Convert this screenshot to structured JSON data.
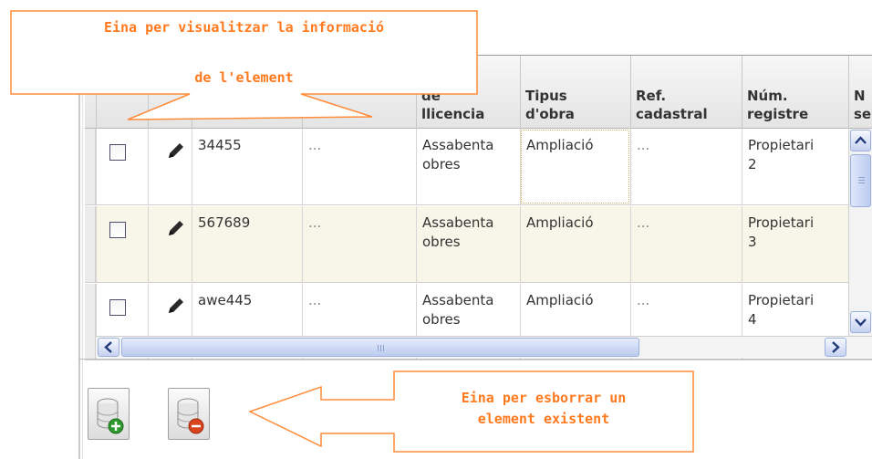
{
  "grid": {
    "headers": [
      {
        "label": ""
      },
      {
        "label": ""
      },
      {
        "label": ""
      },
      {
        "label": ""
      },
      {
        "label": "de\nllicencia"
      },
      {
        "label": "Tipus\nd'obra"
      },
      {
        "label": "Ref.\ncadastral"
      },
      {
        "label": "Núm.\nregistre"
      },
      {
        "label": "N\nse"
      }
    ],
    "rows": [
      {
        "id": "34455",
        "col3": "...",
        "llicencia": "Assabenta\nobres",
        "tipus": "Ampliació",
        "ref": "...",
        "registre": "Propietari\n2"
      },
      {
        "id": "567689",
        "col3": "...",
        "llicencia": "Assabenta\nobres",
        "tipus": "Ampliació",
        "ref": "...",
        "registre": "Propietari\n3"
      },
      {
        "id": "awe445",
        "col3": "...",
        "llicencia": "Assabenta\nobres",
        "tipus": "Ampliació",
        "ref": "...",
        "registre": "Propietari\n4"
      }
    ]
  },
  "icons": {
    "row_edit": "pencil-icon",
    "checkbox": "checkbox",
    "add": "database-add-icon",
    "delete": "database-delete-icon",
    "scroll_up": "chevron-up-icon",
    "scroll_down": "chevron-down-icon",
    "scroll_left": "chevron-left-icon",
    "scroll_right": "chevron-right-icon"
  },
  "callouts": {
    "view_tool": {
      "line1": "Eina per visualitzar la informació",
      "line2": "de l'element"
    },
    "delete_tool": {
      "line1": "Eina per esborrar un",
      "line2": "element existent"
    }
  },
  "colors": {
    "callout": "#ff7a1f",
    "row_alt": "#f7f6e8",
    "scroll_accent": "#9bb0da",
    "add_badge": "#2e9a2e",
    "delete_badge": "#d9431e"
  }
}
